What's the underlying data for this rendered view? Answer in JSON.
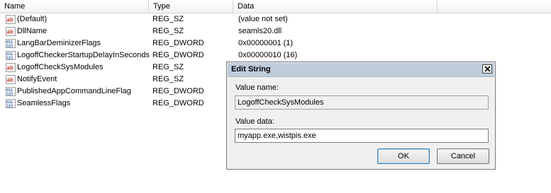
{
  "columns": {
    "name": "Name",
    "type": "Type",
    "data": "Data"
  },
  "rows": [
    {
      "icon": "string-value-icon",
      "name": "(Default)",
      "type": "REG_SZ",
      "data": "(value not set)"
    },
    {
      "icon": "string-value-icon",
      "name": "DllName",
      "type": "REG_SZ",
      "data": "seamls20.dll"
    },
    {
      "icon": "binary-value-icon",
      "name": "LangBarDeminizerFlags",
      "type": "REG_DWORD",
      "data": "0x00000001 (1)"
    },
    {
      "icon": "binary-value-icon",
      "name": "LogoffCheckerStartupDelayInSeconds",
      "type": "REG_DWORD",
      "data": "0x00000010 (16)"
    },
    {
      "icon": "string-value-icon",
      "name": "LogoffCheckSysModules",
      "type": "REG_SZ",
      "data": ""
    },
    {
      "icon": "string-value-icon",
      "name": "NotifyEvent",
      "type": "REG_SZ",
      "data": ""
    },
    {
      "icon": "binary-value-icon",
      "name": "PublishedAppCommandLineFlag",
      "type": "REG_DWORD",
      "data": ""
    },
    {
      "icon": "binary-value-icon",
      "name": "SeamlessFlags",
      "type": "REG_DWORD",
      "data": ""
    }
  ],
  "dialog": {
    "title": "Edit String",
    "value_name_label": "Value name:",
    "value_name": "LogoffCheckSysModules",
    "value_data_label": "Value data:",
    "value_data": "myapp.exe,wistpis.exe",
    "ok_label": "OK",
    "cancel_label": "Cancel"
  },
  "colors": {
    "string_icon": "#c0392b",
    "binary_icon": "#2f5fa8",
    "titlebar": "#bfcddb"
  }
}
